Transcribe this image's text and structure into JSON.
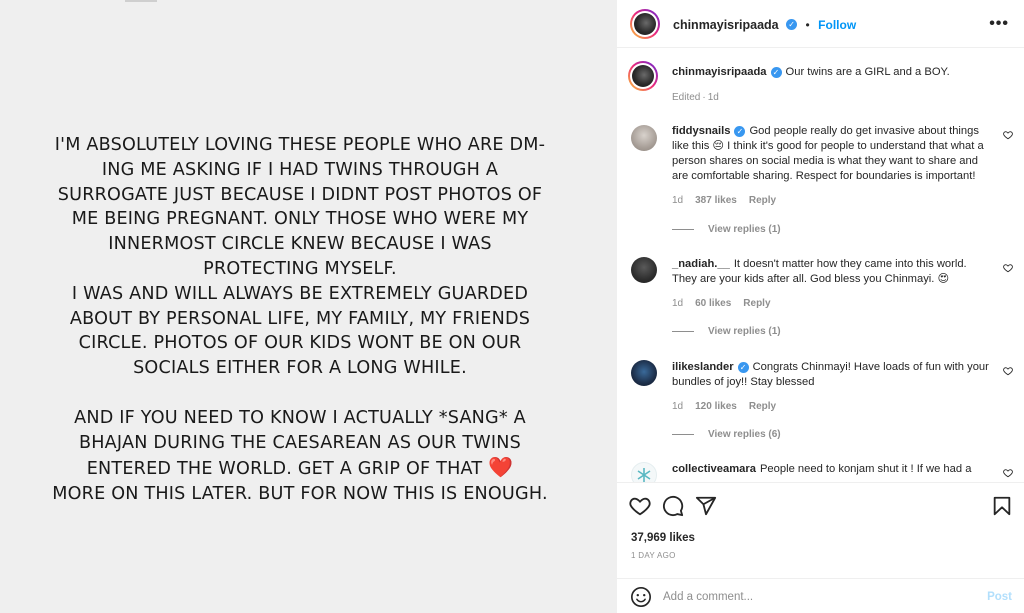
{
  "media": {
    "lines_1": [
      "I'M ABSOLUTELY LOVING THESE PEOPLE WHO ARE DM-",
      "ING ME ASKING IF I HAD TWINS THROUGH A",
      "SURROGATE JUST BECAUSE I DIDNT POST PHOTOS OF",
      "ME BEING PREGNANT. ONLY THOSE WHO WERE MY",
      "INNERMOST CIRCLE KNEW BECAUSE I WAS",
      "PROTECTING MYSELF.",
      "I WAS AND WILL ALWAYS BE EXTREMELY GUARDED",
      "ABOUT BY PERSONAL LIFE, MY FAMILY, MY FRIENDS",
      "CIRCLE. PHOTOS OF OUR KIDS WONT BE ON OUR",
      "SOCIALS EITHER FOR A LONG WHILE."
    ],
    "lines_2": [
      "AND IF YOU NEED TO KNOW I ACTUALLY *SANG* A",
      "BHAJAN DURING THE CAESAREAN AS OUR TWINS",
      "ENTERED THE WORLD. GET A GRIP OF THAT"
    ],
    "heart": "❤️",
    "last_line": "MORE ON THIS LATER. BUT FOR NOW THIS IS ENOUGH."
  },
  "header": {
    "username": "chinmayisripaada",
    "verified": "✓",
    "dot": "•",
    "follow": "Follow",
    "more": "•••"
  },
  "caption": {
    "username": "chinmayisripaada",
    "text": "Our twins are a GIRL and a BOY.",
    "edited": "Edited",
    "dot": "·",
    "time": "1d"
  },
  "comments": [
    {
      "username": "fiddysnails",
      "verified": true,
      "text": "God people really do get invasive about things like this 😔 I think it's good for people to understand that what a person shares on social media is what they want to share and are comfortable sharing. Respect for boundaries is important!",
      "time": "1d",
      "likes": "387 likes",
      "reply": "Reply",
      "view_replies": "View replies (1)"
    },
    {
      "username": "_nadiah.__",
      "verified": false,
      "text": "It doesn't matter how they came into this world. They are your kids after all. God bless you Chinmayi. 😍",
      "time": "1d",
      "likes": "60 likes",
      "reply": "Reply",
      "view_replies": "View replies (1)"
    },
    {
      "username": "ilikeslander",
      "verified": true,
      "text": "Congrats Chinmayi! Have loads of fun with your bundles of joy!! Stay blessed",
      "time": "1d",
      "likes": "120 likes",
      "reply": "Reply",
      "view_replies": "View replies (6)"
    },
    {
      "username": "collectiveamara",
      "verified": false,
      "text": "People need to konjam shut it ! If we had a",
      "time": "",
      "likes": "",
      "reply": "",
      "view_replies": ""
    }
  ],
  "actions": {
    "likes": "37,969 likes",
    "date": "1 DAY AGO",
    "comment_placeholder": "Add a comment...",
    "post": "Post"
  },
  "icons": [
    "heart-icon",
    "comment-icon",
    "share-icon",
    "bookmark-icon",
    "emoji-icon",
    "more-options-icon"
  ],
  "colors": {
    "accent": "#0095f6",
    "verified": "#3897f0",
    "post_disabled": "#b2dffc"
  }
}
